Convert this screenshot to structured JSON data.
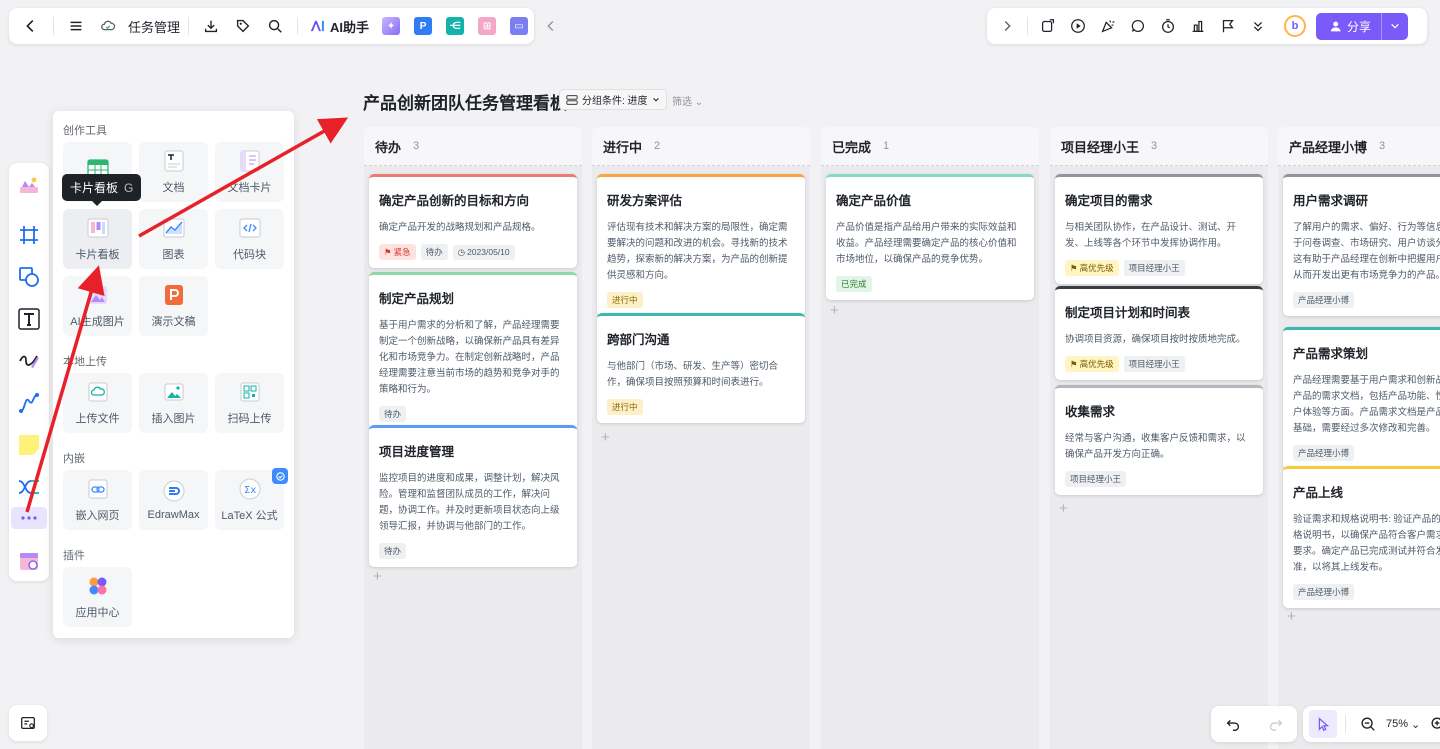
{
  "toolbar": {
    "doc_name": "任务管理",
    "ai_label": "AI助手"
  },
  "share": {
    "label": "分享"
  },
  "panel": {
    "sections": {
      "create": "创作工具",
      "upload": "本地上传",
      "embed": "内嵌",
      "plugin": "插件"
    },
    "tiles": {
      "table": "",
      "doc": "文档",
      "doc_card": "文档卡片",
      "kanban": "卡片看板",
      "chart": "图表",
      "code": "代码块",
      "ai_image": "AI生成图片",
      "slides": "演示文稿",
      "upload_file": "上传文件",
      "insert_image": "插入图片",
      "scan_upload": "扫码上传",
      "embed_web": "嵌入网页",
      "edrawmax": "EdrawMax",
      "latex": "LaTeX 公式",
      "app_center": "应用中心"
    },
    "tooltip": {
      "label": "卡片看板",
      "key": "G"
    }
  },
  "board": {
    "title": "产品创新团队任务管理看板",
    "groupby": "分组条件: 进度",
    "filter": "筛选",
    "columns": [
      {
        "title": "待办",
        "count": "3",
        "cards": [
          {
            "title": "确定产品创新的目标和方向",
            "desc": "确定产品开发的战略规划和产品规格。",
            "tags": [
              "紧急",
              "待办",
              "2023/05/10"
            ],
            "color": "#f07a72"
          },
          {
            "title": "制定产品规划",
            "desc": "基于用户需求的分析和了解，产品经理需要制定一个创新战略，以确保新产品具有差异化和市场竞争力。在制定创新战略时，产品经理需要注意当前市场的趋势和竞争对手的策略和行为。",
            "tags": [
              "待办"
            ],
            "color": "#8fd9a8"
          },
          {
            "title": "项目进度管理",
            "desc": "监控项目的进度和成果，调整计划，解决风险。管理和监督团队成员的工作，解决问题，协调工作。并及时更新项目状态向上级领导汇报，并协调与他部门的工作。",
            "tags": [
              "待办"
            ],
            "color": "#5b9df5"
          }
        ]
      },
      {
        "title": "进行中",
        "count": "2",
        "cards": [
          {
            "title": "研发方案评估",
            "desc": "评估现有技术和解决方案的局限性，确定需要解决的问题和改进的机会。寻找新的技术趋势，探索新的解决方案，为产品的创新提供灵感和方向。",
            "tags": [
              "进行中"
            ],
            "color": "#f5a742"
          },
          {
            "title": "跨部门沟通",
            "desc": "与他部门（市场、研发、生产等）密切合作，确保项目按照预算和时间表进行。",
            "tags": [
              "进行中"
            ],
            "color": "#3bb8b0"
          }
        ]
      },
      {
        "title": "已完成",
        "count": "1",
        "cards": [
          {
            "title": "确定产品价值",
            "desc": "产品价值是指产品给用户带来的实际效益和收益。产品经理需要确定产品的核心价值和市场地位，以确保产品的竞争优势。",
            "tags": [
              "已完成"
            ],
            "color": "#86d9c4"
          }
        ]
      },
      {
        "title": "项目经理小王",
        "count": "3",
        "cards": [
          {
            "title": "确定项目的需求",
            "desc": "与相关团队协作，在产品设计、测试、开发、上线等各个环节中发挥协调作用。",
            "tags": [
              "高优先级",
              "项目经理小王"
            ],
            "color": "#8f959e"
          },
          {
            "title": "制定项目计划和时间表",
            "desc": "协调项目资源，确保项目按时按质地完成。",
            "tags": [
              "高优先级",
              "项目经理小王"
            ],
            "color": "#3a3d42"
          },
          {
            "title": "收集需求",
            "desc": "经常与客户沟通，收集客户反馈和需求，以确保产品开发方向正确。",
            "tags": [
              "项目经理小王"
            ],
            "color": "#b4b7bc"
          }
        ]
      },
      {
        "title": "产品经理小博",
        "count": "3",
        "cards": [
          {
            "title": "用户需求调研",
            "desc": "了解用户的需求、偏好、行为等信息，不限于问卷调查、市场研究、用户访谈分析等。这有助于产品经理在创新中把握用户需求，从而开发出更有市场竞争力的产品。",
            "tags": [
              "产品经理小博"
            ],
            "color": "#8f959e"
          },
          {
            "title": "产品需求策划",
            "desc": "产品经理需要基于用户需求和创新战略制定产品的需求文档，包括产品功能、性能、用户体验等方面。产品需求文档是产品开发的基础，需要经过多次修改和完善。",
            "tags": [
              "产品经理小博"
            ],
            "color": "#3bb8b0"
          },
          {
            "title": "产品上线",
            "desc": "验证需求和规格说明书: 验证产品的需求和规格说明书，以确保产品符合客户需求和规格要求。确定产品已完成测试并符合发布标准，以将其上线发布。",
            "tags": [
              "产品经理小博"
            ],
            "color": "#f5cb3a"
          }
        ]
      }
    ]
  },
  "zoom": {
    "value": "75%"
  },
  "colors": {
    "accent": "#7a5af8",
    "arrow": "#e8202a"
  }
}
